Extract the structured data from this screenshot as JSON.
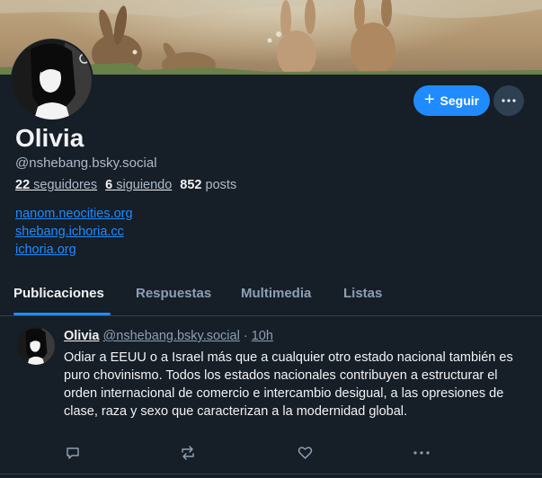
{
  "profile": {
    "name": "Olivia",
    "handle": "@nshebang.bsky.social",
    "followers_count": "22",
    "followers_label": "seguidores",
    "following_count": "6",
    "following_label": "siguiendo",
    "posts_count": "852",
    "posts_label": "posts",
    "links": [
      "nanom.neocities.org",
      "shebang.ichoria.cc",
      "ichoria.org"
    ]
  },
  "actions": {
    "follow_label": "Seguir"
  },
  "tabs": [
    {
      "label": "Publicaciones",
      "active": true
    },
    {
      "label": "Respuestas",
      "active": false
    },
    {
      "label": "Multimedia",
      "active": false
    },
    {
      "label": "Listas",
      "active": false
    }
  ],
  "post": {
    "author": "Olivia",
    "handle": "@nshebang.bsky.social",
    "separator": "·",
    "time": "10h",
    "text": "Odiar a EEUU o a Israel más que a cualquier otro estado nacional también es puro chovinismo. Todos los estados nacionales contribuyen a estructurar el orden internacional de comercio e intercambio desigual, a las opresiones de clase, raza y sexo que caracterizan a la modernidad global."
  },
  "colors": {
    "background": "#161e27",
    "accent": "#208bfe",
    "muted": "#8d9fb3",
    "border": "#2e4052"
  }
}
